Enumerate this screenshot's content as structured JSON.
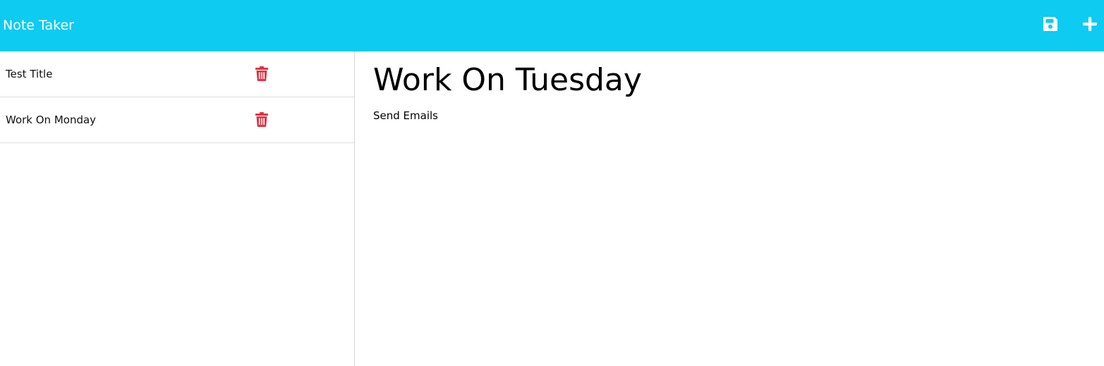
{
  "app": {
    "title": "Note Taker"
  },
  "toolbar": {
    "save_icon": "save-icon",
    "new_icon": "plus-icon"
  },
  "sidebar": {
    "items": [
      {
        "label": "Test Title",
        "delete_icon": "trash-icon"
      },
      {
        "label": "Work On Monday",
        "delete_icon": "trash-icon"
      }
    ]
  },
  "note": {
    "title": "Work On Tuesday",
    "text": "Send Emails"
  },
  "colors": {
    "navbar_bg": "#0ecbf1",
    "delete_icon": "#dc3545",
    "nav_icon": "#ffffff"
  }
}
